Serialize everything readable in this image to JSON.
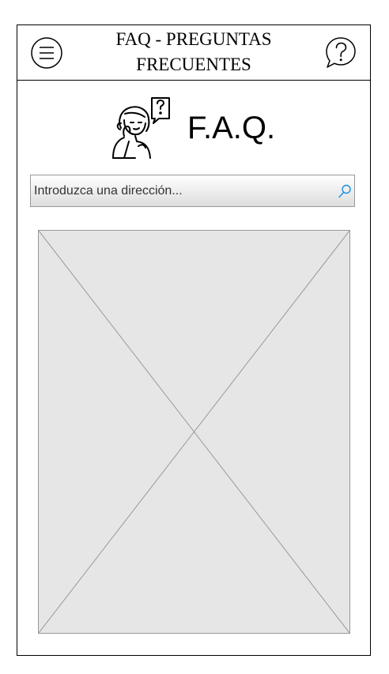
{
  "header": {
    "title_line1": "FAQ - PREGUNTAS",
    "title_line2": "FRECUENTES",
    "menu_icon": "hamburger-menu-icon",
    "help_icon": "question-speech-bubble-icon"
  },
  "hero": {
    "illustration": "person-with-question-bubble-icon",
    "heading": "F.A.Q."
  },
  "search": {
    "placeholder": "Introduzca una dirección...",
    "icon": "search-icon"
  },
  "content": {
    "image": "image-placeholder"
  }
}
